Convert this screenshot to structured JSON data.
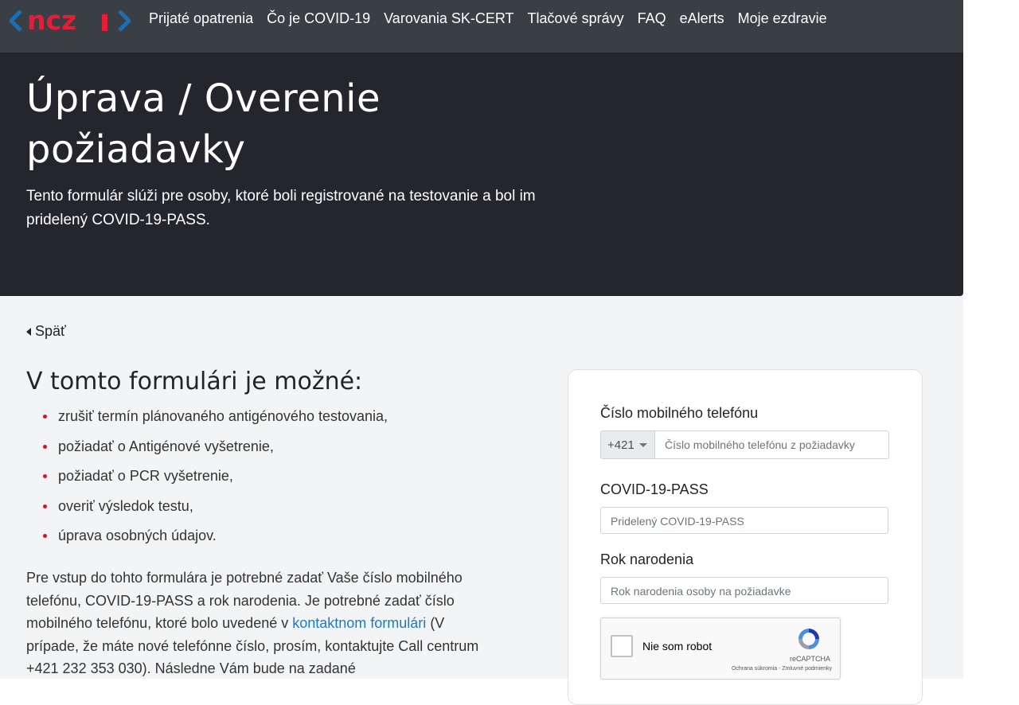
{
  "nav": {
    "logo_text": "ncz",
    "links": [
      "Prijaté opatrenia",
      "Čo je COVID-19",
      "Varovania SK-CERT",
      "Tlačové správy",
      "FAQ",
      "eAlerts",
      "Moje ezdravie"
    ]
  },
  "hero": {
    "title_line1": "Úprava / Overenie",
    "title_line2": "požiadavky",
    "subtitle_line1": "Tento formulár slúži pre osoby, ktoré boli registrované na testovanie a bol im",
    "subtitle_line2": "pridelený COVID-19-PASS."
  },
  "back_label": "Späť",
  "info": {
    "title": "V tomto formulári je možné:",
    "items": [
      "zrušiť termín plánovaného antigénového testovania,",
      "požiadať o Antigénové vyšetrenie,",
      "požiadať o PCR vyšetrenie,",
      "overiť výsledok testu,",
      "úprava osobných údajov."
    ],
    "para_before_link": "Pre vstup do tohto formulára je potrebné zadať Vaše číslo mobilného telefónu, COVID-19-PASS a rok narodenia. Je potrebné zadať číslo mobilného telefónu, ktoré bolo uvedené v ",
    "para_link": "kontaktnom formulári",
    "para_after_link": " (V prípade, že máte nové telefónne číslo, prosím, kontaktujte Call centrum +421 232 353 030). Následne Vám bude na zadané"
  },
  "form": {
    "phone_label": "Číslo mobilného telefónu",
    "phone_prefix": "+421",
    "phone_placeholder": "Číslo mobilného telefónu z požiadavky",
    "pass_label": "COVID-19-PASS",
    "pass_placeholder": "Pridelený COVID-19-PASS",
    "year_label": "Rok narodenia",
    "year_placeholder": "Rok narodenia osoby na požiadavke",
    "captcha_label": "Nie som robot",
    "captcha_brand": "reCAPTCHA",
    "captcha_terms": "Ochrana súkromia - Zmluvné podmienky"
  },
  "colors": {
    "navbar": "#3a3f45",
    "hero": "#24252d",
    "logo_red": "#e31e36",
    "logo_blue": "#1a6fb5",
    "bullet": "#d0172a",
    "link": "#1c7ac9"
  }
}
